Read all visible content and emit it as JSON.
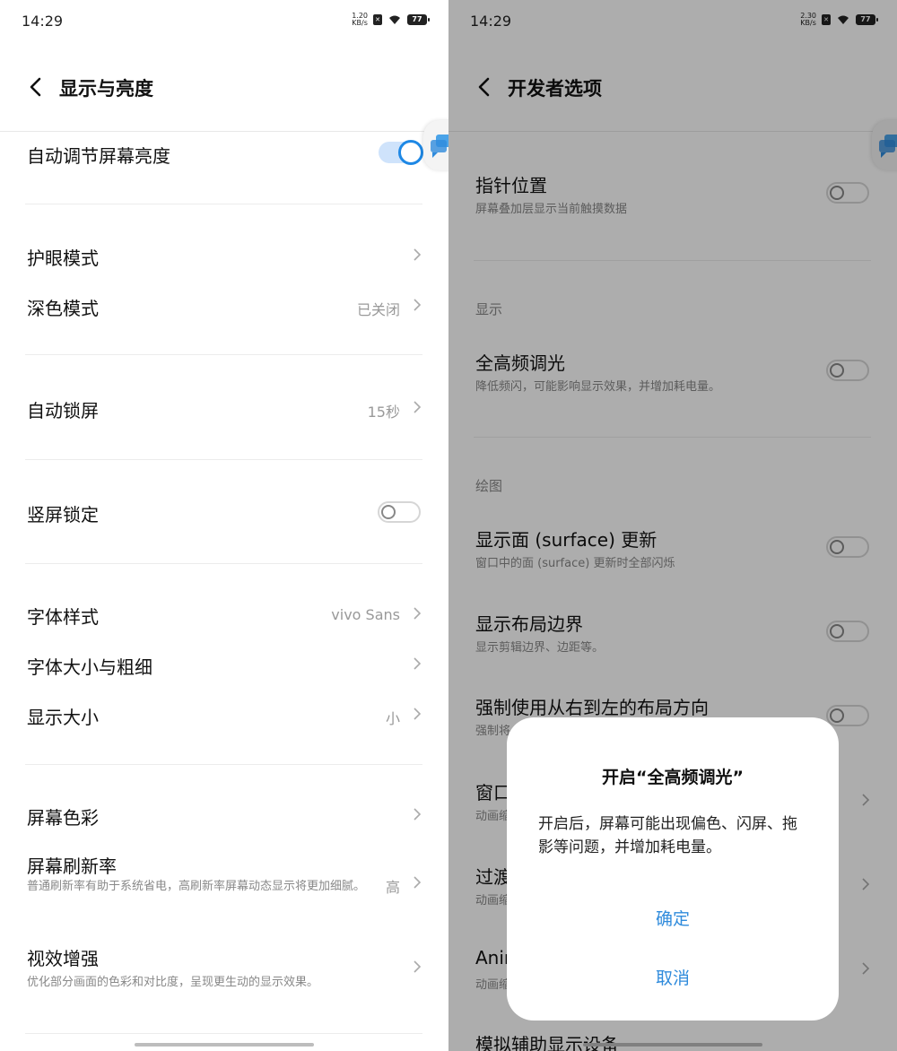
{
  "colors": {
    "accent": "#1e88e5",
    "dialog_button": "#2f8bdc"
  },
  "left": {
    "status": {
      "time": "14:29",
      "speed_top": "1.20",
      "speed_unit": "KB/s",
      "battery": "77"
    },
    "header": {
      "title": "显示与亮度"
    },
    "items": {
      "auto_brightness": "自动调节屏幕亮度",
      "eye_care": "护眼模式",
      "dark_mode": "深色模式",
      "dark_mode_value": "已关闭",
      "auto_lock": "自动锁屏",
      "auto_lock_value": "15秒",
      "portrait_lock": "竖屏锁定",
      "font_style": "字体样式",
      "font_style_value": "vivo Sans",
      "font_size": "字体大小与粗细",
      "display_size": "显示大小",
      "display_size_value": "小",
      "screen_color": "屏幕色彩",
      "refresh_rate": "屏幕刷新率",
      "refresh_rate_desc": "普通刷新率有助于系统省电，高刷新率屏幕动态显示将更加细腻。",
      "refresh_rate_value": "高",
      "visual_enhance": "视效增强",
      "visual_enhance_desc": "优化部分画面的色彩和对比度，呈现更生动的显示效果。"
    }
  },
  "right": {
    "status": {
      "time": "14:29",
      "speed_top": "2.30",
      "speed_unit": "KB/s",
      "battery": "77"
    },
    "header": {
      "title": "开发者选项"
    },
    "items": {
      "pointer_location": "指针位置",
      "pointer_location_desc": "屏幕叠加层显示当前触摸数据",
      "section_display": "显示",
      "dc_dimming": "全高频调光",
      "dc_dimming_desc": "降低频闪，可能影响显示效果，并增加耗电量。",
      "section_drawing": "绘图",
      "surface_updates": "显示面 (surface) 更新",
      "surface_updates_desc": "窗口中的面 (surface) 更新时全部闪烁",
      "layout_bounds": "显示布局边界",
      "layout_bounds_desc": "显示剪辑边界、边距等。",
      "rtl_layout": "强制使用从右到左的布局方向",
      "rtl_layout_desc_partial": "强制将",
      "window_anim_partial": "窗口",
      "window_anim_desc_partial": "动画缩",
      "transition_anim_partial": "过渡",
      "transition_anim_desc_partial": "动画缩",
      "animator_partial": "Anim",
      "animator_desc_partial": "动画缩",
      "simulate_display": "模拟辅助显示设备"
    },
    "dialog": {
      "title": "开启“全高频调光”",
      "message": "开启后，屏幕可能出现偏色、闪屏、拖影等问题，并增加耗电量。",
      "confirm": "确定",
      "cancel": "取消"
    }
  }
}
